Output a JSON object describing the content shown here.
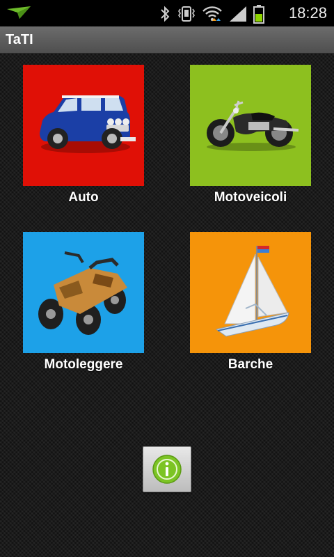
{
  "status_bar": {
    "time": "18:28",
    "icons": [
      "notification-arrow-icon",
      "bluetooth-icon",
      "vibrate-icon",
      "wifi-icon",
      "signal-icon",
      "battery-icon"
    ]
  },
  "app": {
    "title": "TaTI"
  },
  "tiles": [
    {
      "label": "Auto",
      "color": "#e01006",
      "icon": "car-icon"
    },
    {
      "label": "Motoveicoli",
      "color": "#8dc01f",
      "icon": "motorcycle-icon"
    },
    {
      "label": "Motoleggere",
      "color": "#1da1e8",
      "icon": "quad-bike-icon"
    },
    {
      "label": "Barche",
      "color": "#f5940a",
      "icon": "sailboat-icon"
    }
  ],
  "info_button": {
    "icon": "info-icon",
    "accent": "#7cc424"
  }
}
